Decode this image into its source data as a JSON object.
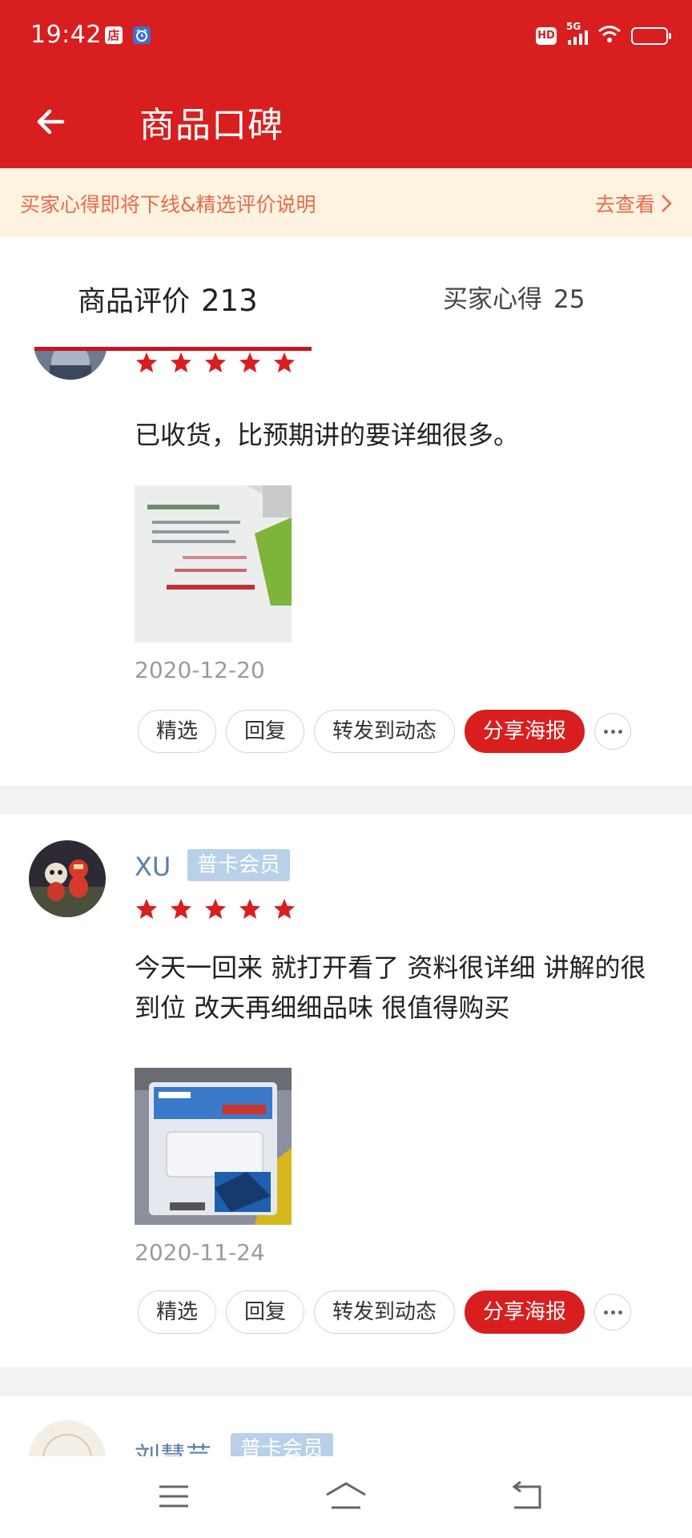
{
  "status_bar": {
    "time": "19:42",
    "badge_shop": "店",
    "badge_alarm": "",
    "hd": "HD",
    "network": "5G"
  },
  "header": {
    "title": "商品口碑",
    "back_icon": "arrow-left-icon"
  },
  "notice": {
    "text": "买家心得即将下线&精选评价说明",
    "link": "去查看"
  },
  "tabs": [
    {
      "label": "商品评价",
      "count": "213",
      "active": true
    },
    {
      "label": "买家心得",
      "count": "25",
      "active": false
    }
  ],
  "reviews": [
    {
      "user": "",
      "badge": "",
      "rating": 5,
      "text": "已收货，比预期讲的要详细很多。",
      "date": "2020-12-20",
      "actions": [
        "精选",
        "回复",
        "转发到动态",
        "分享海报"
      ]
    },
    {
      "user": "XU",
      "badge": "普卡会员",
      "rating": 5,
      "text": "今天一回来 就打开看了 资料很详细 讲解的很到位 改天再细细品味 很值得购买",
      "date": "2020-11-24",
      "actions": [
        "精选",
        "回复",
        "转发到动态",
        "分享海报"
      ]
    },
    {
      "user": "刘慧芸",
      "badge": "普卡会员"
    }
  ],
  "colors": {
    "brand_red": "#d81e1e",
    "notice_bg": "#fdf3e0",
    "notice_text": "#e86a4c",
    "username": "#5a7fa8",
    "member_badge": "#b8d0e8"
  },
  "nav": {
    "menu_icon": "menu-icon",
    "home_icon": "home-icon",
    "back_icon": "back-icon"
  }
}
